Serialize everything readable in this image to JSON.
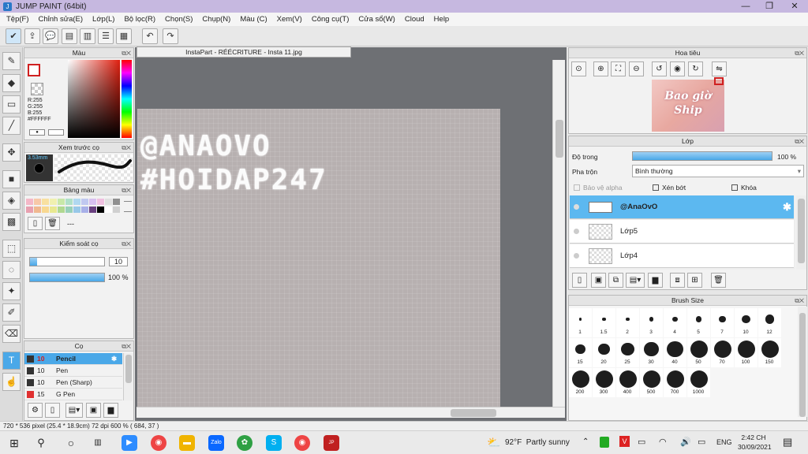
{
  "window": {
    "title": "JUMP PAINT (64bit)"
  },
  "menu": [
    "Tệp(F)",
    "Chỉnh sửa(E)",
    "Lớp(L)",
    "Bộ lọc(R)",
    "Chọn(S)",
    "Chụp(N)",
    "Màu (C)",
    "Xem(V)",
    "Công cụ(T)",
    "Cửa sổ(W)",
    "Cloud",
    "Help"
  ],
  "color_panel": {
    "title": "Màu",
    "r": "R:255",
    "g": "G:255",
    "b": "B:255",
    "hex": "#FFFFFF"
  },
  "brush_preview": {
    "title": "Xem trước cọ",
    "size": "3.53mm"
  },
  "palette": {
    "title": "Bảng màu",
    "extra": "---",
    "colors": [
      "#f4b8c8",
      "#f7c8a8",
      "#f8e0a0",
      "#f0f0b0",
      "#c8e8a8",
      "#b0e0c8",
      "#b0d8f0",
      "#c0c8f0",
      "#d8c0f0",
      "#f0c0e0",
      "#e0e0e0",
      "#909090",
      "#e8a0b0",
      "#f0b890",
      "#f8d890",
      "#e8e890",
      "#b0d890",
      "#98d0b8",
      "#98c8e8",
      "#a8b0e8",
      "#6a4080",
      "#000000",
      "#ffffff",
      "#d0d0d0"
    ]
  },
  "brush_control": {
    "title": "Kiểm soát cọ",
    "size_value": "10",
    "opacity_value": "100 %",
    "size_fill": 0.1,
    "opacity_fill": 1.0
  },
  "brush_list": {
    "title": "Cọ",
    "items": [
      {
        "size": "10",
        "name": "Pencil",
        "color": "#333333",
        "selected": true
      },
      {
        "size": "10",
        "name": "Pen",
        "color": "#333333",
        "selected": false
      },
      {
        "size": "10",
        "name": "Pen (Sharp)",
        "color": "#333333",
        "selected": false
      },
      {
        "size": "15",
        "name": "G Pen",
        "color": "#e03030",
        "selected": false
      }
    ]
  },
  "document": {
    "tab": "InstaPart - RÉÉCRITURE - Insta 11.jpg",
    "line1": "@ANAOVO",
    "line2": "#HOIDAP247"
  },
  "navigator": {
    "title": "Hoa tiêu",
    "thumb_line1": "Bao giờ",
    "thumb_line2": "Ship"
  },
  "layer_panel": {
    "title": "Lớp",
    "opacity_label": "Độ trong",
    "opacity_value": "100 %",
    "opacity_fill": 1.0,
    "blend_label": "Pha trộn",
    "blend_value": "Bình thường",
    "protect_alpha": "Bảo vệ alpha",
    "clipping": "Xén bớt",
    "lock": "Khóa",
    "layers": [
      {
        "name": "@AnaOvO",
        "selected": true
      },
      {
        "name": "Lớp5",
        "selected": false
      },
      {
        "name": "Lớp4",
        "selected": false
      }
    ]
  },
  "brush_size": {
    "title": "Brush Size",
    "sizes": [
      "1",
      "1.5",
      "2",
      "3",
      "4",
      "5",
      "7",
      "10",
      "12",
      "15",
      "20",
      "25",
      "30",
      "40",
      "50",
      "70",
      "100",
      "150",
      "200",
      "300",
      "400",
      "500",
      "700",
      "1000"
    ]
  },
  "status": {
    "text": "720 * 536 pixel  (25.4 * 18.9cm)  72 dpi  600 %  ( 684, 37 )"
  },
  "taskbar": {
    "weather_temp": "92°F",
    "weather_text": "Partly sunny",
    "lang": "ENG",
    "time": "2:42 CH",
    "date": "30/09/2021"
  },
  "colors": {
    "accent": "#4aa8e8",
    "titlebar": "#c6b8e0",
    "canvas_bg": "#6e7074"
  }
}
